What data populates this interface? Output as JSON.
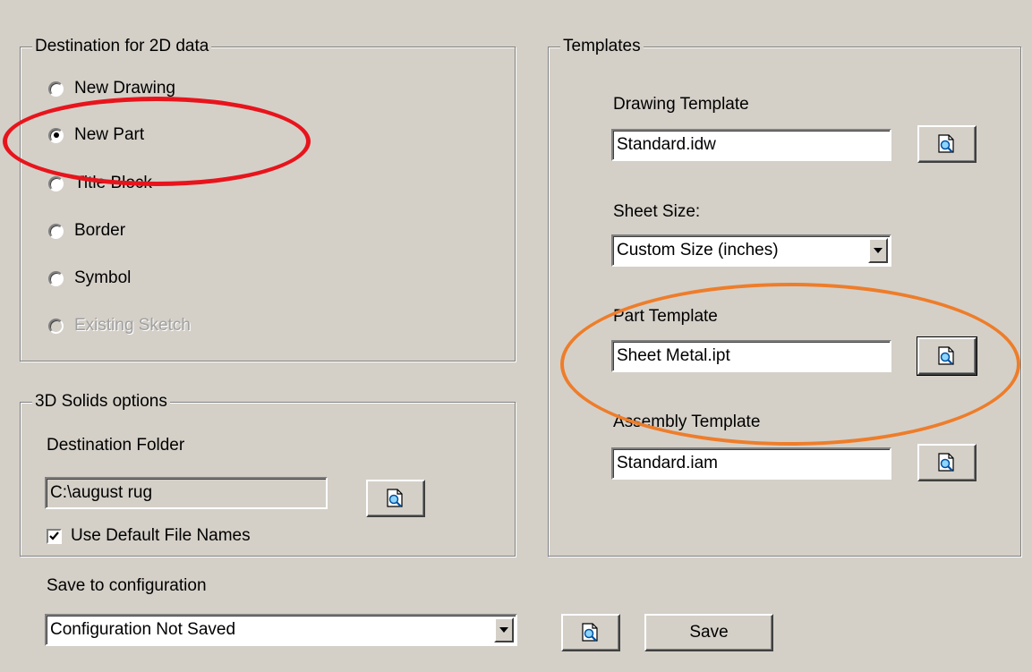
{
  "destination_group": {
    "title": "Destination for 2D data",
    "options": [
      {
        "label": "New Drawing",
        "selected": false,
        "disabled": false
      },
      {
        "label": "New Part",
        "selected": true,
        "disabled": false
      },
      {
        "label": "Title Block",
        "selected": false,
        "disabled": false
      },
      {
        "label": "Border",
        "selected": false,
        "disabled": false
      },
      {
        "label": "Symbol",
        "selected": false,
        "disabled": false
      },
      {
        "label": "Existing Sketch",
        "selected": false,
        "disabled": true
      }
    ]
  },
  "solids_group": {
    "title": "3D Solids options",
    "folder_label": "Destination Folder",
    "folder_value": "C:\\august rug",
    "browse_icon": "browse-folder-icon",
    "use_default_names_label": "Use Default File Names",
    "use_default_names_checked": true
  },
  "templates_group": {
    "title": "Templates",
    "drawing_template_label": "Drawing Template",
    "drawing_template_value": "Standard.idw",
    "sheet_size_label": "Sheet Size:",
    "sheet_size_value": "Custom Size (inches)",
    "part_template_label": "Part Template",
    "part_template_value": "Sheet Metal.ipt",
    "assembly_template_label": "Assembly Template",
    "assembly_template_value": "Standard.iam"
  },
  "configuration": {
    "label": "Save to configuration",
    "value": "Configuration Not Saved",
    "save_label": "Save"
  },
  "annotations": {
    "red_circle_color": "#e8141c",
    "orange_circle_color": "#ee7d2a"
  }
}
